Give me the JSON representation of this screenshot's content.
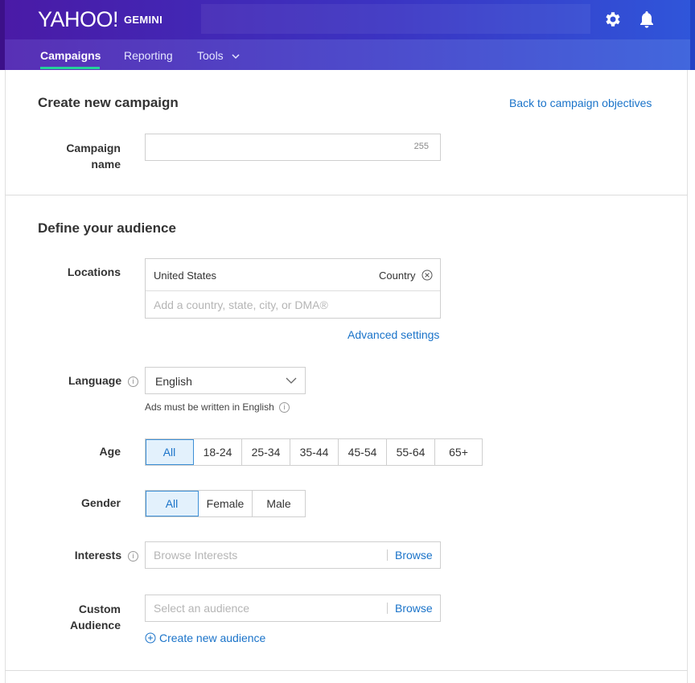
{
  "header": {
    "logo": "YAHOO!",
    "product": "GEMINI",
    "icons": [
      "gear-icon",
      "bell-icon"
    ]
  },
  "nav": {
    "items": [
      {
        "label": "Campaigns",
        "active": true
      },
      {
        "label": "Reporting",
        "active": false
      },
      {
        "label": "Tools",
        "active": false
      }
    ]
  },
  "campaign": {
    "title": "Create new campaign",
    "back_link": "Back to campaign objectives",
    "name_label_line1": "Campaign",
    "name_label_line2": "name",
    "name_value": "",
    "name_counter": "255"
  },
  "audience": {
    "title": "Define your audience",
    "locations": {
      "label": "Locations",
      "selected": "United States",
      "selected_type": "Country",
      "placeholder": "Add a country, state, city, or DMA®",
      "advanced_link": "Advanced settings"
    },
    "language": {
      "label": "Language",
      "value": "English",
      "note": "Ads must be written in English"
    },
    "age": {
      "label": "Age",
      "options": [
        "All",
        "18-24",
        "25-34",
        "35-44",
        "45-54",
        "55-64",
        "65+"
      ],
      "selected": "All"
    },
    "gender": {
      "label": "Gender",
      "options": [
        "All",
        "Female",
        "Male"
      ],
      "selected": "All"
    },
    "interests": {
      "label": "Interests",
      "placeholder": "Browse Interests",
      "browse": "Browse"
    },
    "custom_audience": {
      "label_line1": "Custom",
      "label_line2": "Audience",
      "placeholder": "Select an audience",
      "browse": "Browse",
      "create_link": "Create new audience"
    }
  },
  "colors": {
    "header_start": "#4a1aa6",
    "header_end": "#2f56da",
    "link": "#1a73c9",
    "active_underline": "#24d39a",
    "selected_bg": "#e3f1fc"
  }
}
